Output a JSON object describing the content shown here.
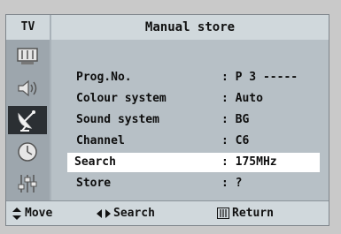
{
  "header": {
    "source_label": "TV",
    "title": "Manual store"
  },
  "sidebar": {
    "icons": [
      "picture-icon",
      "sound-icon",
      "channel-icon",
      "timer-icon",
      "setup-icon"
    ],
    "active": "channel-icon"
  },
  "menu": {
    "rows": [
      {
        "label": "Prog.No.",
        "value": ": P 3 -----"
      },
      {
        "label": "Colour system",
        "value": ": Auto"
      },
      {
        "label": "Sound system",
        "value": ": BG"
      },
      {
        "label": "Channel",
        "value": ": C6"
      },
      {
        "label": "Search",
        "value": ": 175MHz",
        "selected": true
      },
      {
        "label": "Store",
        "value": ": ?"
      }
    ]
  },
  "footer": {
    "move_label": "Move",
    "search_label": "Search",
    "return_label": "Return"
  },
  "colors": {
    "frame": "#a9b2b9",
    "titlebar": "#d0d8dc",
    "content": "#b7c0c6",
    "selected_row": "#ffffff",
    "active_icon_bg": "#2b2f33"
  }
}
